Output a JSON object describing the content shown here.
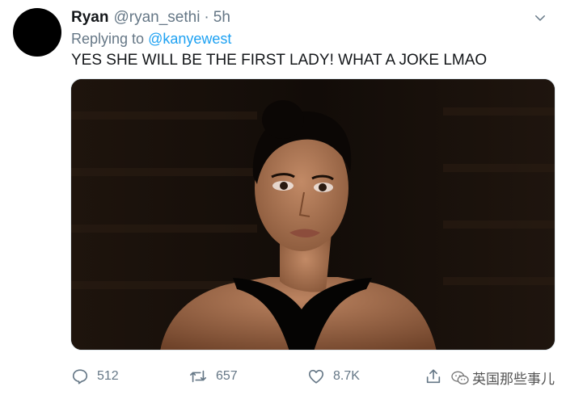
{
  "tweet": {
    "display_name": "Ryan",
    "handle": "@ryan_sethi",
    "separator": "·",
    "timestamp": "5h",
    "replying_to_prefix": "Replying to",
    "replying_to_mention": "@kanyewest",
    "text": "YES SHE WILL BE THE FIRST LADY! WHAT A JOKE LMAO",
    "media": {
      "kind": "photo",
      "subject": "woman with dark hair in a bun wearing a black halter top against a dark background"
    },
    "actions": {
      "reply_count": "512",
      "retweet_count": "657",
      "like_count": "8.7K"
    }
  },
  "icons": {
    "more": "chevron-down-icon",
    "reply": "speech-bubble-icon",
    "retweet": "retweet-arrows-icon",
    "like": "heart-icon",
    "share": "share-upload-icon"
  },
  "watermark": {
    "text": "英国那些事儿"
  },
  "colors": {
    "text_primary": "#14171a",
    "text_secondary": "#657786",
    "link": "#1da1f2"
  }
}
